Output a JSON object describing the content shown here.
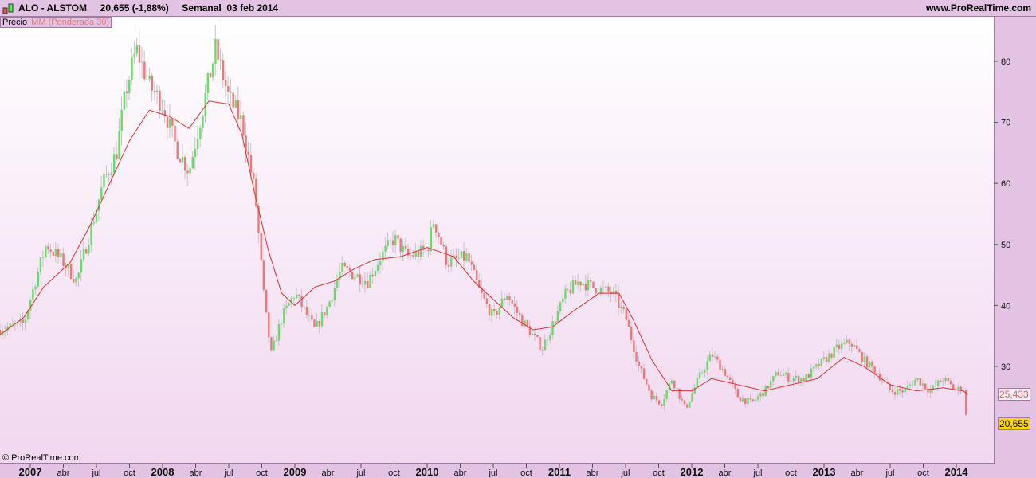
{
  "header": {
    "symbol": "ALO - ALSTOM",
    "price": "20,655 (-1,88%)",
    "period": "Semanal  03 feb 2014",
    "site": "www.ProRealTime.com"
  },
  "legend": {
    "price": "Precio",
    "ma": "MM (Ponderada 30)"
  },
  "copyright": "© ProRealTime.com",
  "colors": {
    "up": "#66dd66",
    "down": "#ee7777",
    "neutral": "#bbbbbb",
    "ma": "#dd3333"
  },
  "chart_data": {
    "type": "candlestick",
    "title": "ALO - ALSTOM Semanal",
    "ylim": [
      18,
      87
    ],
    "yticks": [
      30,
      40,
      50,
      60,
      70,
      80
    ],
    "xticks": [
      {
        "t": 2007,
        "label": "2007",
        "major": true
      },
      {
        "t": 2007.25,
        "label": "abr"
      },
      {
        "t": 2007.5,
        "label": "jul"
      },
      {
        "t": 2007.75,
        "label": "oct"
      },
      {
        "t": 2008,
        "label": "2008",
        "major": true
      },
      {
        "t": 2008.25,
        "label": "abr"
      },
      {
        "t": 2008.5,
        "label": "jul"
      },
      {
        "t": 2008.75,
        "label": "oct"
      },
      {
        "t": 2009,
        "label": "2009",
        "major": true
      },
      {
        "t": 2009.25,
        "label": "abr"
      },
      {
        "t": 2009.5,
        "label": "jul"
      },
      {
        "t": 2009.75,
        "label": "oct"
      },
      {
        "t": 2010,
        "label": "2010",
        "major": true
      },
      {
        "t": 2010.25,
        "label": "abr"
      },
      {
        "t": 2010.5,
        "label": "jul"
      },
      {
        "t": 2010.75,
        "label": "oct"
      },
      {
        "t": 2011,
        "label": "2011",
        "major": true
      },
      {
        "t": 2011.25,
        "label": "abr"
      },
      {
        "t": 2011.5,
        "label": "jul"
      },
      {
        "t": 2011.75,
        "label": "oct"
      },
      {
        "t": 2012,
        "label": "2012",
        "major": true
      },
      {
        "t": 2012.25,
        "label": "abr"
      },
      {
        "t": 2012.5,
        "label": "jul"
      },
      {
        "t": 2012.75,
        "label": "oct"
      },
      {
        "t": 2013,
        "label": "2013",
        "major": true
      },
      {
        "t": 2013.25,
        "label": "abr"
      },
      {
        "t": 2013.5,
        "label": "jul"
      },
      {
        "t": 2013.75,
        "label": "oct"
      },
      {
        "t": 2014,
        "label": "2014",
        "major": true
      }
    ],
    "price_anchors": [
      [
        2006.77,
        36
      ],
      [
        2006.95,
        37
      ],
      [
        2007.05,
        45
      ],
      [
        2007.12,
        50
      ],
      [
        2007.25,
        47
      ],
      [
        2007.35,
        44
      ],
      [
        2007.45,
        52
      ],
      [
        2007.55,
        60
      ],
      [
        2007.65,
        65
      ],
      [
        2007.72,
        75
      ],
      [
        2007.8,
        82
      ],
      [
        2007.9,
        76
      ],
      [
        2008.0,
        73
      ],
      [
        2008.1,
        66
      ],
      [
        2008.2,
        62
      ],
      [
        2008.3,
        72
      ],
      [
        2008.4,
        82
      ],
      [
        2008.5,
        74
      ],
      [
        2008.6,
        70
      ],
      [
        2008.7,
        58
      ],
      [
        2008.77,
        40
      ],
      [
        2008.82,
        32
      ],
      [
        2008.9,
        38
      ],
      [
        2009.0,
        42
      ],
      [
        2009.15,
        36
      ],
      [
        2009.25,
        40
      ],
      [
        2009.35,
        46
      ],
      [
        2009.45,
        45
      ],
      [
        2009.55,
        44
      ],
      [
        2009.65,
        48
      ],
      [
        2009.75,
        51
      ],
      [
        2009.85,
        48
      ],
      [
        2010.0,
        49
      ],
      [
        2010.05,
        54
      ],
      [
        2010.15,
        47
      ],
      [
        2010.3,
        48
      ],
      [
        2010.4,
        42
      ],
      [
        2010.5,
        38
      ],
      [
        2010.6,
        42
      ],
      [
        2010.7,
        38
      ],
      [
        2010.8,
        35
      ],
      [
        2010.87,
        33
      ],
      [
        2010.95,
        37
      ],
      [
        2011.05,
        42
      ],
      [
        2011.15,
        44
      ],
      [
        2011.25,
        43
      ],
      [
        2011.4,
        42
      ],
      [
        2011.5,
        38
      ],
      [
        2011.6,
        30
      ],
      [
        2011.7,
        25
      ],
      [
        2011.77,
        24
      ],
      [
        2011.85,
        28
      ],
      [
        2011.95,
        23
      ],
      [
        2012.05,
        28
      ],
      [
        2012.15,
        32
      ],
      [
        2012.25,
        29
      ],
      [
        2012.35,
        25
      ],
      [
        2012.45,
        24
      ],
      [
        2012.55,
        26
      ],
      [
        2012.65,
        29
      ],
      [
        2012.75,
        28
      ],
      [
        2012.85,
        28
      ],
      [
        2012.95,
        30
      ],
      [
        2013.1,
        33
      ],
      [
        2013.2,
        34
      ],
      [
        2013.3,
        31
      ],
      [
        2013.4,
        29
      ],
      [
        2013.5,
        26
      ],
      [
        2013.6,
        26
      ],
      [
        2013.7,
        28
      ],
      [
        2013.8,
        26
      ],
      [
        2013.9,
        28
      ],
      [
        2014.0,
        26
      ],
      [
        2014.05,
        27
      ],
      [
        2014.07,
        22
      ],
      [
        2014.09,
        20.655
      ]
    ],
    "ma_name": "MM (Ponderada 30)",
    "ma_anchors": [
      [
        2006.77,
        35.2
      ],
      [
        2006.95,
        38
      ],
      [
        2007.1,
        43
      ],
      [
        2007.3,
        47
      ],
      [
        2007.45,
        53
      ],
      [
        2007.6,
        60
      ],
      [
        2007.75,
        67
      ],
      [
        2007.9,
        72
      ],
      [
        2008.05,
        71
      ],
      [
        2008.2,
        69
      ],
      [
        2008.35,
        73.5
      ],
      [
        2008.5,
        73
      ],
      [
        2008.6,
        68
      ],
      [
        2008.7,
        58
      ],
      [
        2008.8,
        49
      ],
      [
        2008.9,
        42
      ],
      [
        2009.0,
        40
      ],
      [
        2009.15,
        43
      ],
      [
        2009.3,
        44
      ],
      [
        2009.45,
        46
      ],
      [
        2009.6,
        47.5
      ],
      [
        2009.8,
        48
      ],
      [
        2010.0,
        49.5
      ],
      [
        2010.2,
        48
      ],
      [
        2010.35,
        44
      ],
      [
        2010.5,
        41
      ],
      [
        2010.65,
        38
      ],
      [
        2010.8,
        36
      ],
      [
        2010.95,
        36.5
      ],
      [
        2011.1,
        39
      ],
      [
        2011.3,
        42
      ],
      [
        2011.45,
        42
      ],
      [
        2011.55,
        38
      ],
      [
        2011.7,
        31
      ],
      [
        2011.85,
        26
      ],
      [
        2012.0,
        26
      ],
      [
        2012.15,
        28
      ],
      [
        2012.35,
        27
      ],
      [
        2012.55,
        26
      ],
      [
        2012.75,
        27
      ],
      [
        2012.95,
        28
      ],
      [
        2013.15,
        31.5
      ],
      [
        2013.3,
        30
      ],
      [
        2013.5,
        27
      ],
      [
        2013.7,
        26
      ],
      [
        2013.9,
        26.5
      ],
      [
        2014.05,
        26
      ],
      [
        2014.09,
        25.433
      ]
    ],
    "last_price": "20,655",
    "last_ma": "25,433"
  }
}
